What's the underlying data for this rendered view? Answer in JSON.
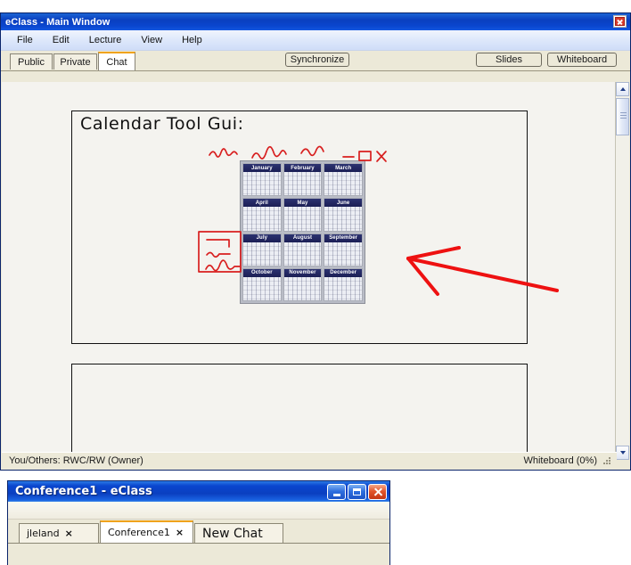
{
  "main_window": {
    "title": "eClass - Main Window",
    "close_icon": "close-icon",
    "menu": [
      "File",
      "Edit",
      "Lecture",
      "View",
      "Help"
    ],
    "tabs": [
      {
        "label": "Public",
        "active": false
      },
      {
        "label": "Private",
        "active": false
      },
      {
        "label": "Chat",
        "active": true
      }
    ],
    "toolbar_buttons": {
      "synchronize": "Synchronize",
      "slides": "Slides",
      "whiteboard": "Whiteboard"
    },
    "statusbar": {
      "left": "You/Others: RWC/RW  (Owner)",
      "right": "Whiteboard (0%)"
    },
    "scrollbar": {
      "up_icon": "chevron-up-icon",
      "down_icon": "chevron-down-icon",
      "thumb": "scrollbar-thumb"
    }
  },
  "whiteboard": {
    "heading": "Calendar Tool Gui:",
    "calendar": {
      "months": [
        "January",
        "February",
        "March",
        "April",
        "May",
        "June",
        "July",
        "August",
        "September",
        "October",
        "November",
        "December"
      ]
    },
    "annotations": {
      "color": "#d81f1f",
      "arrow_color": "#ee1111",
      "sketch_titlebar": "red-squiggle-titlebar-sketch",
      "sketch_minimize": "red-minimize-sketch",
      "sketch_maximize": "red-maximize-sketch",
      "sketch_close": "red-close-sketch",
      "sketch_left_box": "red-box-sketch",
      "arrow": "red-arrow-pointing-to-calendar"
    }
  },
  "chat_window": {
    "title": "Conference1  -  eClass",
    "window_buttons": {
      "minimize": "minimize-icon",
      "maximize": "maximize-icon",
      "close": "close-icon"
    },
    "tabs": [
      {
        "label": "jleland",
        "closable": true,
        "active": false,
        "big": false
      },
      {
        "label": "Conference1",
        "closable": true,
        "active": true,
        "big": false
      },
      {
        "label": "New Chat",
        "closable": false,
        "active": false,
        "big": true
      }
    ],
    "close_glyph": "×"
  }
}
